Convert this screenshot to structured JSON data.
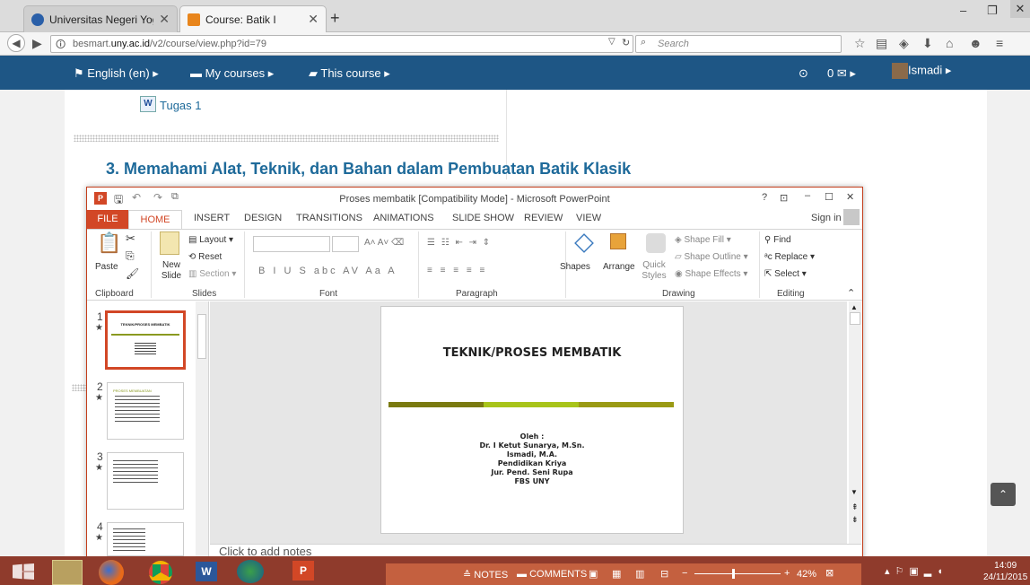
{
  "browser": {
    "tabs": [
      {
        "title": "Universitas Negeri Yogyak...",
        "active": false
      },
      {
        "title": "Course: Batik I",
        "active": true
      }
    ],
    "new_tab": "+",
    "url_prefix": "besmart.",
    "url_domain": "uny.ac.id",
    "url_path": "/v2/course/view.php?id=79",
    "search_placeholder": "Search"
  },
  "moodle_nav": {
    "language": "English (en) ▸",
    "my_courses": "My courses ▸",
    "this_course": "This course ▸",
    "messages": "0 ✉ ▸",
    "user": "Ismadi ▸"
  },
  "page": {
    "assignment_link": "Tugas 1",
    "section_heading": "3. Memahami Alat, Teknik, dan Bahan dalam Pembuatan Batik Klasik"
  },
  "powerpoint": {
    "window_title": "Proses membatik [Compatibility Mode] - Microsoft PowerPoint",
    "sign_in": "Sign in",
    "tabs": [
      "FILE",
      "HOME",
      "INSERT",
      "DESIGN",
      "TRANSITIONS",
      "ANIMATIONS",
      "SLIDE SHOW",
      "REVIEW",
      "VIEW"
    ],
    "groups": [
      "Clipboard",
      "Slides",
      "Font",
      "Paragraph",
      "Drawing",
      "Editing"
    ],
    "clipboard": {
      "paste": "Paste"
    },
    "slides_group": {
      "new_slide": "New Slide",
      "layout": "Layout",
      "reset": "Reset",
      "section": "Section"
    },
    "drawing": {
      "shapes": "Shapes",
      "arrange": "Arrange",
      "quick_styles": "Quick Styles",
      "shape_fill": "Shape Fill",
      "shape_outline": "Shape Outline",
      "shape_effects": "Shape Effects"
    },
    "editing": {
      "find": "Find",
      "replace": "Replace",
      "select": "Select"
    },
    "thumbnails": [
      {
        "num": "1",
        "title": "TEKNIK/PROSES MEMBATIK"
      },
      {
        "num": "2",
        "title": "PROSES MEMBUATAN"
      },
      {
        "num": "3",
        "title": ""
      },
      {
        "num": "4",
        "title": ""
      }
    ],
    "slide": {
      "title": "TEKNIK/PROSES MEMBATIK",
      "by_label": "Oleh :",
      "authors": [
        "Dr. I Ketut Sunarya, M.Sn.",
        "Ismadi, M.A.",
        "Pendidikan Kriya",
        "Jur. Pend. Seni Rupa",
        "FBS UNY"
      ],
      "bar_colors": [
        "#7a7a10",
        "#a8c41a",
        "#9a9a14"
      ]
    },
    "notes_placeholder": "Click to add notes",
    "status": {
      "notes": "NOTES",
      "comments": "COMMENTS",
      "zoom": "42%"
    }
  },
  "taskbar": {
    "time": "14:09",
    "date": "24/11/2015"
  }
}
